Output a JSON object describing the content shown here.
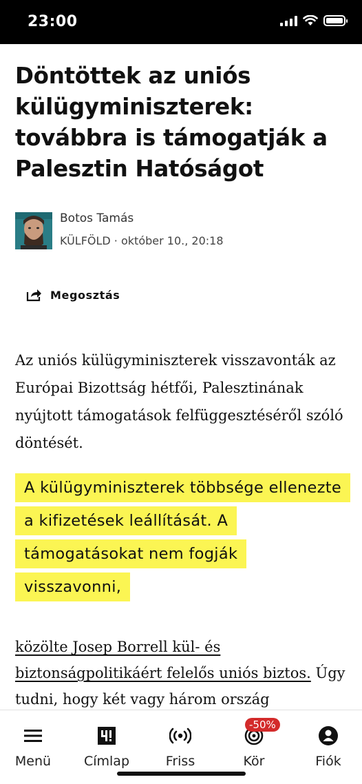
{
  "status_bar": {
    "time": "23:00"
  },
  "article": {
    "title": "Döntöttek az uniós külügyminiszterek: továbbra is támogatják a Palesztin Hatóságot",
    "author": "Botos Tamás",
    "section": "KÜLFÖLD",
    "separator": " · ",
    "date": "október 10., 20:18",
    "share_label": "Megosztás",
    "lead": "Az uniós külügyminiszterek visszavonták az Európai Bizottság hétfői, Palesztinának nyújtott támogatások felfüggesztéséről szóló döntését.",
    "quote": "A külügyminiszterek többsége ellenezte a kifizetések leállítását. A támogatásokat nem fogják visszavonni,",
    "link_text": "közölte Josep Borrell kül- és biztonságpolitikáért felelős uniós biztos.",
    "body_continuation": " Úgy tudni, hogy két vagy három ország"
  },
  "bottom_nav": {
    "items": [
      {
        "label": "Menü",
        "icon": "hamburger-menu-icon"
      },
      {
        "label": "Címlap",
        "icon": "444-logo-icon"
      },
      {
        "label": "Friss",
        "icon": "broadcast-icon"
      },
      {
        "label": "Kör",
        "icon": "target-circle-icon"
      },
      {
        "label": "Fiók",
        "icon": "account-icon"
      }
    ],
    "badge": "-50%"
  },
  "colors": {
    "highlight": "#fbf553",
    "badge": "#d32b2b",
    "avatar_bg": "#2a7d86"
  }
}
